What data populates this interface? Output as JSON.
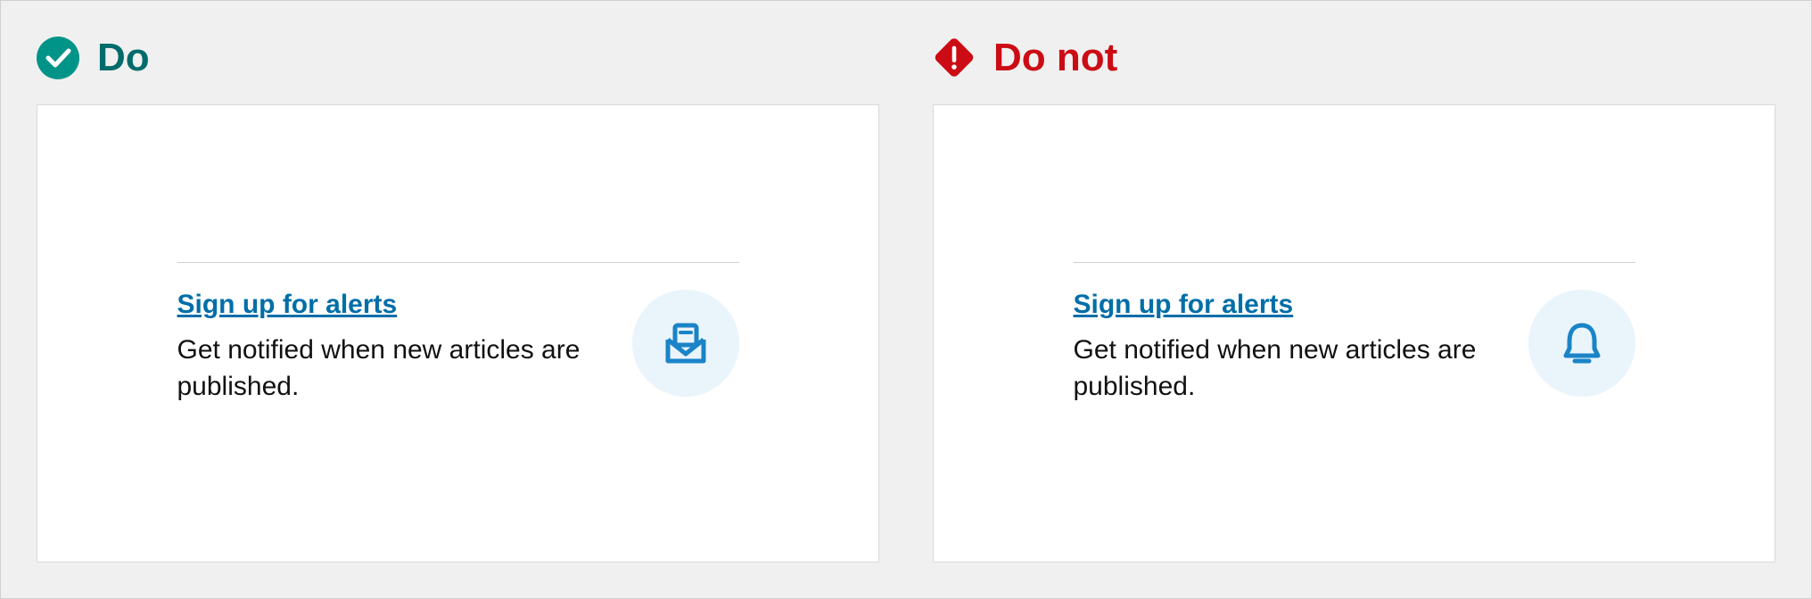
{
  "left": {
    "header": "Do",
    "link": "Sign up for alerts",
    "description": "Get notified when new articles are published.",
    "icon": "envelope-open-icon"
  },
  "right": {
    "header": "Do not",
    "link": "Sign up for alerts",
    "description": "Get notified when new articles are published.",
    "icon": "bell-icon"
  },
  "colors": {
    "do": "#009488",
    "donot": "#cc0c14",
    "link": "#006ea8",
    "iconCircleBg": "#eaf4fb",
    "iconStroke": "#1a84c7"
  }
}
